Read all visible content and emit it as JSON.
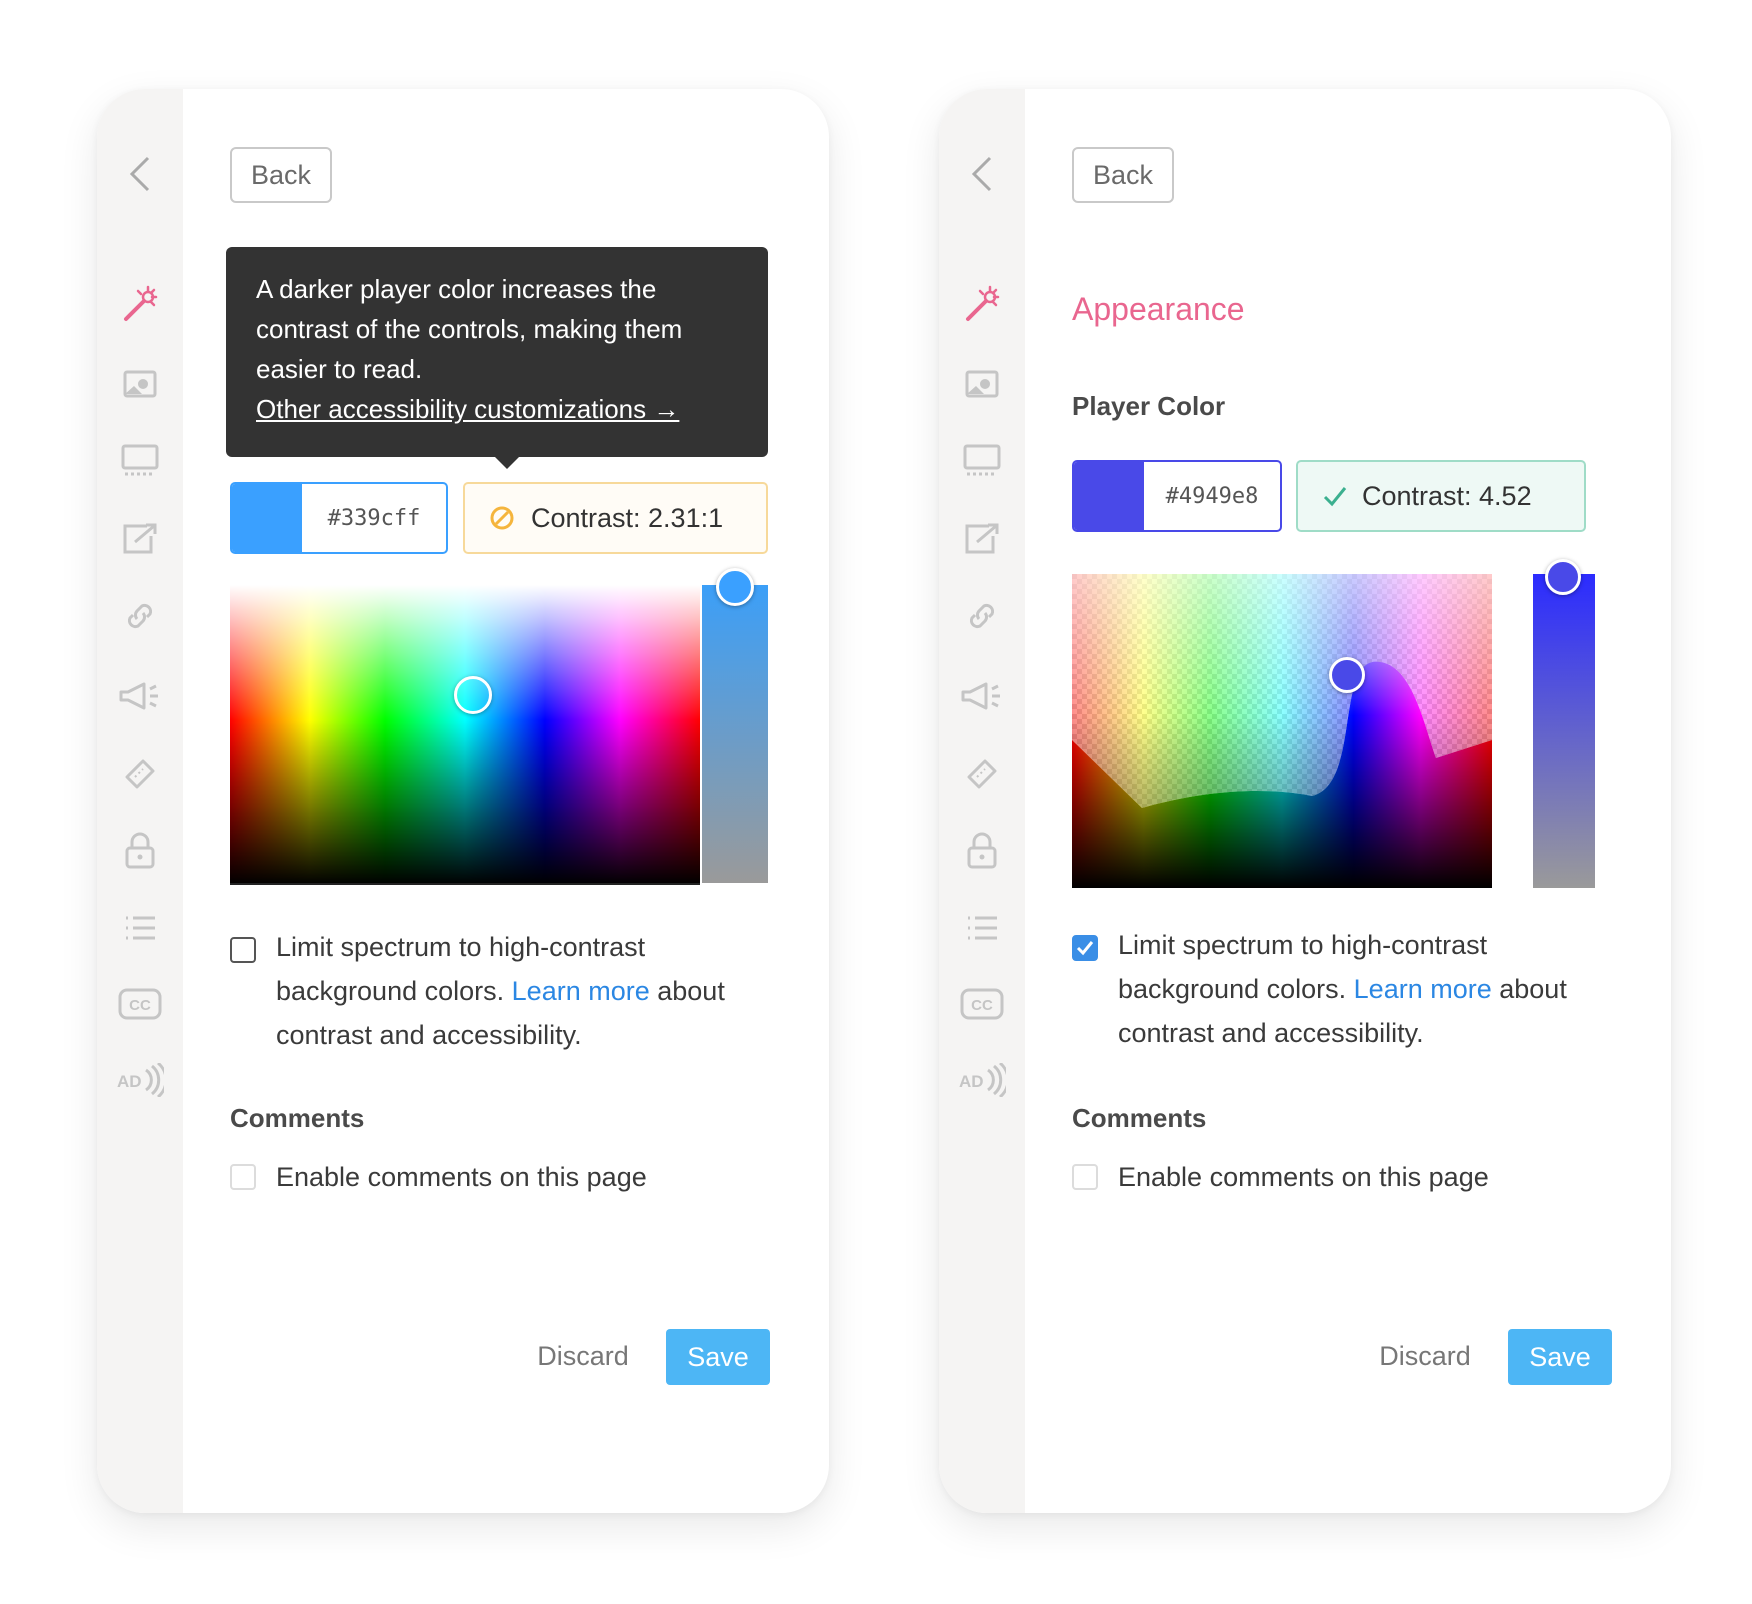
{
  "colors": {
    "brand_pink": "#e9668f",
    "link_blue": "#2b87e3",
    "save_blue": "#4db6f5",
    "warning_orange": "#f5b53d",
    "success_green": "#3bb08f"
  },
  "rail_icons": [
    "chevron-left-icon",
    "magic-wand-icon",
    "image-icon",
    "monitor-icon",
    "share-icon",
    "link-icon",
    "megaphone-icon",
    "ticket-icon",
    "lock-icon",
    "list-icon",
    "closed-captions-icon",
    "audio-description-icon"
  ],
  "left": {
    "back_label": "Back",
    "tooltip": {
      "text": "A darker player color increases the contrast of the controls, making them easier to read.",
      "link": "Other accessibility customizations →"
    },
    "hex_value": "#339cff",
    "swatch_color": "#3aa0ff",
    "contrast_label": "Contrast: 2.31:1",
    "contrast_status": "fail",
    "limit": {
      "checked": false,
      "text_before": "Limit spectrum to high-contrast background colors.",
      "link": "Learn more",
      "text_after": "about contrast and accessibility."
    },
    "comments_label": "Comments",
    "comments_checkbox": "Enable comments on this page",
    "discard_label": "Discard",
    "save_label": "Save"
  },
  "right": {
    "back_label": "Back",
    "section_title": "Appearance",
    "player_color_label": "Player Color",
    "hex_value": "#4949e8",
    "swatch_color": "#4949e8",
    "contrast_label": "Contrast: 4.52",
    "contrast_status": "pass",
    "limit": {
      "checked": true,
      "text_before": "Limit spectrum to high-contrast background colors.",
      "link": "Learn more",
      "text_after": "about contrast and accessibility."
    },
    "comments_label": "Comments",
    "comments_checkbox": "Enable comments on this page",
    "discard_label": "Discard",
    "save_label": "Save"
  }
}
